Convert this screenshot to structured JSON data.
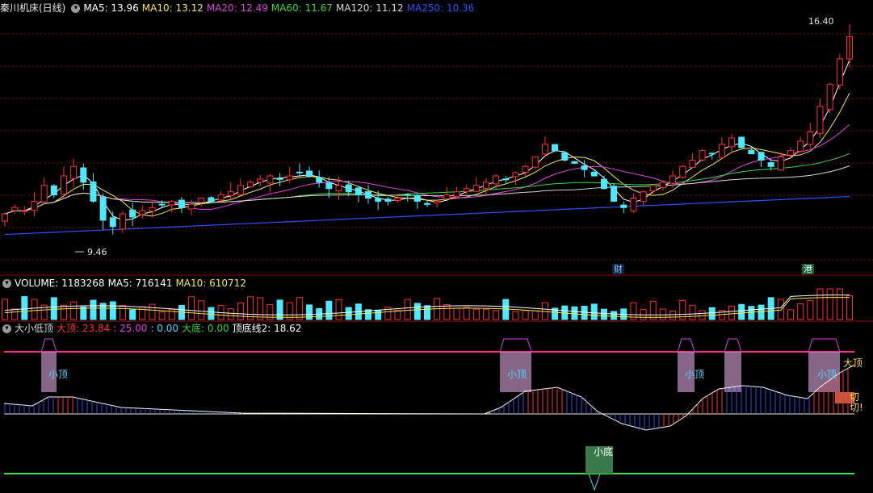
{
  "price_header": {
    "title": "秦川机床(日线)",
    "ma": [
      {
        "label": "MA5: 13.96",
        "color": "#ffffff"
      },
      {
        "label": "MA10: 13.12",
        "color": "#f5e84a"
      },
      {
        "label": "MA20: 12.49",
        "color": "#e040e0"
      },
      {
        "label": "MA60: 11.67",
        "color": "#38d838"
      },
      {
        "label": "MA120: 11.12",
        "color": "#d8d8d8"
      },
      {
        "label": "MA250: 10.36",
        "color": "#3050ff"
      }
    ]
  },
  "volume_header": {
    "items": [
      {
        "label": "VOLUME: 1183268",
        "color": "#ffffff"
      },
      {
        "label": "MA5: 716141",
        "color": "#ffffff"
      },
      {
        "label": "MA10: 610712",
        "color": "#f5e84a"
      }
    ]
  },
  "indicator_header": {
    "title": "大小低顶",
    "items": [
      {
        "label": "大顶: 23.84",
        "color": "#ff3030"
      },
      {
        "label": ": 25.00",
        "color": "#e040e0"
      },
      {
        "label": ": 0.00",
        "color": "#50d8ff"
      },
      {
        "label": "大底: 0.00",
        "color": "#38d838"
      },
      {
        "label": "顶底线2: 18.62",
        "color": "#ffffff"
      }
    ]
  },
  "annotations": {
    "high": "16.40",
    "low": "9.46",
    "tag_cai": "财",
    "tag_gang": "港",
    "xiaoding": "小顶",
    "xiaodi": "小底",
    "dading": "大顶",
    "qieqie": "切切!"
  },
  "chart_data": [
    {
      "type": "candlestick",
      "title": "秦川机床(日线)",
      "high_marker": 16.4,
      "low_marker": 9.46,
      "ylim": [
        9.0,
        16.6
      ],
      "close": [
        10.4,
        10.6,
        10.5,
        10.8,
        11.3,
        11.0,
        11.6,
        11.9,
        11.4,
        10.8,
        10.2,
        10.0,
        10.4,
        10.3,
        10.5,
        10.6,
        10.7,
        10.8,
        10.6,
        10.7,
        10.9,
        10.8,
        11.0,
        11.1,
        11.3,
        11.4,
        11.5,
        11.6,
        11.5,
        11.6,
        11.7,
        11.6,
        11.4,
        11.2,
        11.3,
        11.1,
        11.0,
        10.9,
        10.8,
        10.8,
        10.9,
        11.0,
        10.8,
        10.7,
        10.8,
        11.0,
        11.1,
        11.2,
        11.3,
        11.4,
        11.6,
        11.5,
        11.7,
        11.9,
        12.2,
        12.6,
        12.4,
        12.1,
        12.0,
        11.8,
        11.6,
        11.2,
        10.8,
        10.6,
        10.9,
        11.1,
        11.3,
        11.4,
        11.6,
        11.9,
        12.1,
        12.4,
        12.3,
        12.6,
        12.8,
        12.5,
        12.3,
        12.1,
        11.9,
        12.2,
        12.4,
        12.7,
        13.0,
        13.8,
        14.5,
        15.3,
        16.0
      ],
      "volume_last": 1183268
    },
    {
      "type": "bar",
      "title": "VOLUME",
      "series": [
        {
          "name": "VOLUME",
          "values": [
            1183268
          ]
        },
        {
          "name": "MA5",
          "values": [
            716141
          ]
        },
        {
          "name": "MA10",
          "values": [
            610712
          ]
        }
      ]
    },
    {
      "type": "line",
      "title": "大小低顶",
      "series": [
        {
          "name": "大顶",
          "values": [
            23.84
          ]
        },
        {
          "name": "大底",
          "values": [
            0.0
          ]
        },
        {
          "name": "顶底线2",
          "values": [
            18.62
          ]
        }
      ],
      "top_level": 25.0,
      "bottom_level": 0.0
    }
  ]
}
